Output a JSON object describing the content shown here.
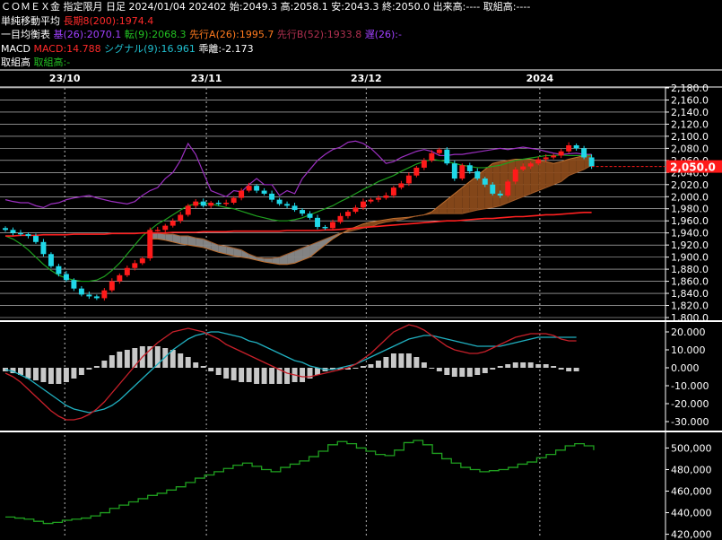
{
  "header": {
    "line1": "ＣＯＭＥＸ金 指定限月 日足 2024/01/04 202402 始:2049.3 高:2058.1 安:2043.3 終:2050.0 出来高:---- 取組高:----",
    "sma_label": "単純移動平均",
    "sma_item": "長期8(200):1974.4",
    "ichimoku_label": "一目均衡表",
    "ichimoku_kijun": "基(26):2070.1",
    "ichimoku_tenkan": "転(9):2068.3",
    "ichimoku_senkou_a": "先行A(26):1995.7",
    "ichimoku_senkou_b": "先行B(52):1933.8",
    "ichimoku_chikou": "遅(26):-",
    "macd_label": "MACD",
    "macd_value": "MACD:14.788",
    "macd_signal": "シグナル(9):16.961",
    "macd_hist": "乖離:-2.173",
    "oi_label": "取組高",
    "oi_item": "取組高:-"
  },
  "colors": {
    "up": "#ff1a1a",
    "down": "#20d8e8",
    "sma": "#ff2020",
    "kijun": "#9b2fc0",
    "tenkan": "#1fa01f",
    "cloud_bull": "#8a4a1a",
    "cloud_bear": "#8a8a8a",
    "macd": "#c8202a",
    "signal": "#20b0c0",
    "hist": "#c8c8c8",
    "oi": "#1f9f1f",
    "price_tag": "#ff1a1a"
  },
  "chart_data": [
    {
      "type": "candlestick",
      "panel": "price",
      "x_ticks": [
        "23/10",
        "23/11",
        "23/12",
        "2024"
      ],
      "y_ticks": [
        "2,180.0",
        "2,160.0",
        "2,140.0",
        "2,120.0",
        "2,100.0",
        "2,080.0",
        "2,060.0",
        "2,040.0",
        "2,020.0",
        "2,000.0",
        "1,980.0",
        "1,960.0",
        "1,940.0",
        "1,920.0",
        "1,900.0",
        "1,880.0",
        "1,860.0",
        "1,840.0",
        "1,820.0",
        "1,800.0"
      ],
      "ylim": [
        1800,
        2180
      ],
      "last_price_label": "2,050.0",
      "ohlc_last": {
        "date": "2024/01/04",
        "open": 2049.3,
        "high": 2058.1,
        "low": 2043.3,
        "close": 2050.0
      },
      "close": [
        1945,
        1940,
        1938,
        1935,
        1925,
        1905,
        1885,
        1872,
        1862,
        1848,
        1838,
        1835,
        1832,
        1845,
        1860,
        1870,
        1882,
        1890,
        1898,
        1945,
        1945,
        1952,
        1960,
        1970,
        1985,
        1992,
        1985,
        1990,
        1988,
        1990,
        1998,
        2010,
        2018,
        2010,
        2005,
        1995,
        1988,
        1985,
        1978,
        1972,
        1965,
        1950,
        1948,
        1958,
        1968,
        1975,
        1982,
        1992,
        1995,
        1998,
        2002,
        2015,
        2022,
        2035,
        2048,
        2060,
        2072,
        2078,
        2055,
        2030,
        2052,
        2042,
        2030,
        2020,
        2005,
        2002,
        2025,
        2045,
        2050,
        2055,
        2062,
        2065,
        2068,
        2075,
        2085,
        2080,
        2065,
        2050
      ],
      "sma200": [
        1935,
        1935,
        1936,
        1936,
        1936,
        1937,
        1937,
        1937,
        1937,
        1938,
        1938,
        1938,
        1938,
        1938,
        1939,
        1939,
        1939,
        1939,
        1940,
        1940,
        1940,
        1940,
        1941,
        1941,
        1941,
        1941,
        1942,
        1942,
        1942,
        1942,
        1943,
        1943,
        1943,
        1943,
        1943,
        1943,
        1943,
        1944,
        1944,
        1944,
        1944,
        1944,
        1945,
        1945,
        1946,
        1947,
        1948,
        1949,
        1950,
        1951,
        1952,
        1953,
        1954,
        1955,
        1956,
        1957,
        1958,
        1959,
        1960,
        1960,
        1961,
        1962,
        1963,
        1964,
        1964,
        1965,
        1966,
        1967,
        1967,
        1968,
        1969,
        1970,
        1970,
        1971,
        1972,
        1973,
        1974,
        1974
      ],
      "kijun": [
        1995,
        1992,
        1990,
        1990,
        1985,
        1982,
        1988,
        1990,
        1995,
        1998,
        2000,
        2002,
        1998,
        1995,
        1992,
        1990,
        1988,
        1992,
        2002,
        2010,
        2015,
        2030,
        2040,
        2060,
        2088,
        2070,
        2040,
        2010,
        2005,
        2000,
        2010,
        2008,
        2020,
        2030,
        2020,
        2020,
        2002,
        2010,
        2005,
        2030,
        2045,
        2060,
        2070,
        2078,
        2082,
        2090,
        2092,
        2088,
        2080,
        2068,
        2055,
        2058,
        2065,
        2070,
        2075,
        2078,
        2075,
        2068,
        2068,
        2070,
        2070,
        2072,
        2074,
        2076,
        2078,
        2080,
        2078,
        2080,
        2082,
        2080,
        2078,
        2075,
        2072,
        2070,
        2071,
        2072,
        2070,
        2070
      ],
      "tenkan": [
        1935,
        1930,
        1922,
        1912,
        1900,
        1888,
        1878,
        1870,
        1865,
        1862,
        1860,
        1860,
        1862,
        1868,
        1878,
        1890,
        1905,
        1920,
        1935,
        1945,
        1955,
        1962,
        1970,
        1978,
        1985,
        1988,
        1990,
        1988,
        1985,
        1982,
        1980,
        1976,
        1972,
        1968,
        1965,
        1962,
        1960,
        1960,
        1962,
        1965,
        1970,
        1975,
        1980,
        1985,
        1992,
        1998,
        2005,
        2012,
        2018,
        2025,
        2030,
        2035,
        2042,
        2048,
        2054,
        2058,
        2062,
        2060,
        2058,
        2055,
        2052,
        2050,
        2048,
        2048,
        2050,
        2052,
        2056,
        2060,
        2062,
        2064,
        2066,
        2068,
        2068,
        2069,
        2068,
        2068,
        2068,
        2068
      ],
      "senkou_a": [
        1930,
        1930,
        1928,
        1925,
        1922,
        1920,
        1918,
        1916,
        1912,
        1908,
        1905,
        1902,
        1900,
        1898,
        1895,
        1892,
        1890,
        1888,
        1888,
        1890,
        1895,
        1900,
        1910,
        1920,
        1930,
        1938,
        1945,
        1950,
        1955,
        1958,
        1960,
        1962,
        1964,
        1965,
        1966,
        1968,
        1970,
        1975,
        1985,
        1995,
        2005,
        2015,
        2025,
        2035,
        2045,
        2055,
        2058,
        2060,
        2062,
        2062,
        2062,
        2060,
        2058,
        2055,
        2058,
        2062,
        2065,
        2068,
        2070
      ],
      "senkou_b": [
        1940,
        1940,
        1938,
        1938,
        1935,
        1935,
        1932,
        1930,
        1925,
        1920,
        1918,
        1915,
        1912,
        1905,
        1900,
        1898,
        1898,
        1900,
        1905,
        1910,
        1915,
        1920,
        1925,
        1930,
        1935,
        1940,
        1942,
        1945,
        1948,
        1950,
        1955,
        1958,
        1960,
        1962,
        1965,
        1968,
        1970,
        1972,
        1972,
        1972,
        1972,
        1972,
        1975,
        1978,
        1980,
        1982,
        1985,
        1990,
        1995,
        2000,
        2005,
        2010,
        2015,
        2020,
        2025,
        2035,
        2040,
        2045,
        2052
      ]
    },
    {
      "type": "macd",
      "panel": "macd",
      "y_ticks": [
        "20.000",
        "10.000",
        "0.000",
        "-10.000",
        "-20.000",
        "-30.000"
      ],
      "ylim": [
        -34,
        24
      ],
      "macd": [
        -3,
        -5,
        -8,
        -12,
        -16,
        -20,
        -24,
        -27,
        -29,
        -29,
        -28,
        -26,
        -23,
        -19,
        -14,
        -9,
        -4,
        1,
        6,
        10,
        14,
        17,
        20,
        21,
        22,
        21,
        20,
        18,
        16,
        13,
        11,
        9,
        7,
        5,
        3,
        1,
        -1,
        -3,
        -4,
        -5,
        -5,
        -4,
        -3,
        -2,
        -1,
        0,
        2,
        5,
        8,
        12,
        16,
        20,
        22,
        24,
        23,
        21,
        18,
        15,
        12,
        10,
        9,
        8,
        8,
        9,
        11,
        13,
        15,
        17,
        18,
        19,
        19,
        19,
        18,
        16,
        15,
        15
      ],
      "signal": [
        -1,
        -2,
        -4,
        -6,
        -9,
        -12,
        -15,
        -18,
        -21,
        -23,
        -24,
        -25,
        -24,
        -23,
        -21,
        -18,
        -14,
        -10,
        -6,
        -2,
        2,
        6,
        10,
        13,
        16,
        18,
        19,
        20,
        20,
        19,
        18,
        17,
        15,
        14,
        12,
        10,
        8,
        6,
        4,
        3,
        1,
        0,
        -1,
        -1,
        0,
        1,
        2,
        4,
        6,
        8,
        10,
        12,
        14,
        16,
        17,
        18,
        18,
        17,
        16,
        15,
        14,
        13,
        12,
        12,
        12,
        12,
        13,
        14,
        15,
        16,
        17,
        17,
        17,
        17,
        17,
        17
      ],
      "hist": [
        -2,
        -3,
        -4,
        -6,
        -7,
        -8,
        -9,
        -9,
        -8,
        -6,
        -4,
        -1,
        1,
        4,
        7,
        9,
        10,
        11,
        12,
        12,
        12,
        11,
        10,
        8,
        6,
        3,
        1,
        -2,
        -4,
        -6,
        -7,
        -8,
        -8,
        -9,
        -9,
        -9,
        -9,
        -9,
        -8,
        -8,
        -6,
        -4,
        -2,
        -1,
        -1,
        -1,
        0,
        1,
        2,
        4,
        6,
        8,
        8,
        8,
        6,
        3,
        0,
        -2,
        -4,
        -5,
        -5,
        -5,
        -4,
        -3,
        -1,
        1,
        2,
        3,
        3,
        3,
        2,
        2,
        1,
        -1,
        -2,
        -2
      ]
    },
    {
      "type": "line",
      "panel": "open_interest",
      "y_ticks": [
        "500,000",
        "480,000",
        "460,000",
        "440,000",
        "420,000"
      ],
      "ylim": [
        418000,
        512000
      ],
      "values": [
        436000,
        435000,
        434000,
        432000,
        430000,
        431000,
        433000,
        434000,
        435000,
        437000,
        440000,
        444000,
        447000,
        450000,
        453000,
        456000,
        458000,
        461000,
        464000,
        468000,
        472000,
        475000,
        478000,
        481000,
        484000,
        486000,
        483000,
        480000,
        478000,
        482000,
        485000,
        488000,
        492000,
        497000,
        503000,
        506000,
        504000,
        500000,
        497000,
        494000,
        493000,
        498000,
        505000,
        507000,
        503000,
        495000,
        490000,
        486000,
        482000,
        480000,
        478000,
        479000,
        480000,
        482000,
        485000,
        487000,
        491000,
        494000,
        498000,
        502000,
        504000,
        502000,
        498000
      ]
    }
  ]
}
